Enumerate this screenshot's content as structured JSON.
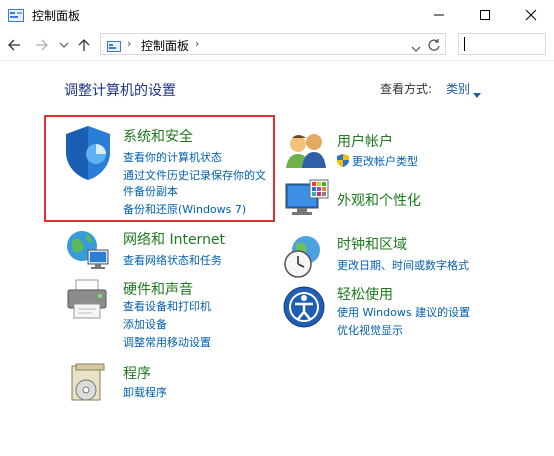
{
  "window": {
    "title": "控制面板",
    "accent": "#1e7a1e"
  },
  "nav": {
    "address_path": "控制面板",
    "back_icon": "arrow-left-icon",
    "forward_icon": "arrow-right-icon",
    "recent_icon": "chevron-down-icon",
    "up_icon": "arrow-up-icon",
    "refresh_icon": "refresh-icon",
    "search_placeholder": ""
  },
  "main": {
    "heading": "调整计算机的设置",
    "view_by_label": "查看方式:",
    "view_by_value": "类别"
  },
  "categories": {
    "security": {
      "title": "系统和安全",
      "links": [
        "查看你的计算机状态",
        "通过文件历史记录保存你的文",
        "件备份副本",
        "备份和还原(Windows 7)"
      ]
    },
    "network": {
      "title": "网络和 Internet",
      "links": [
        "查看网络状态和任务"
      ]
    },
    "hardware": {
      "title": "硬件和声音",
      "links": [
        "查看设备和打印机",
        "添加设备",
        "调整常用移动设置"
      ]
    },
    "programs": {
      "title": "程序",
      "links": [
        "卸载程序"
      ]
    },
    "accounts": {
      "title": "用户帐户",
      "links": [
        "更改帐户类型"
      ]
    },
    "appearance": {
      "title": "外观和个性化",
      "links": []
    },
    "clock": {
      "title": "时钟和区域",
      "links": [
        "更改日期、时间或数字格式"
      ]
    },
    "ease": {
      "title": "轻松使用",
      "links": [
        "使用 Windows 建议的设置",
        "优化视觉显示"
      ]
    }
  }
}
